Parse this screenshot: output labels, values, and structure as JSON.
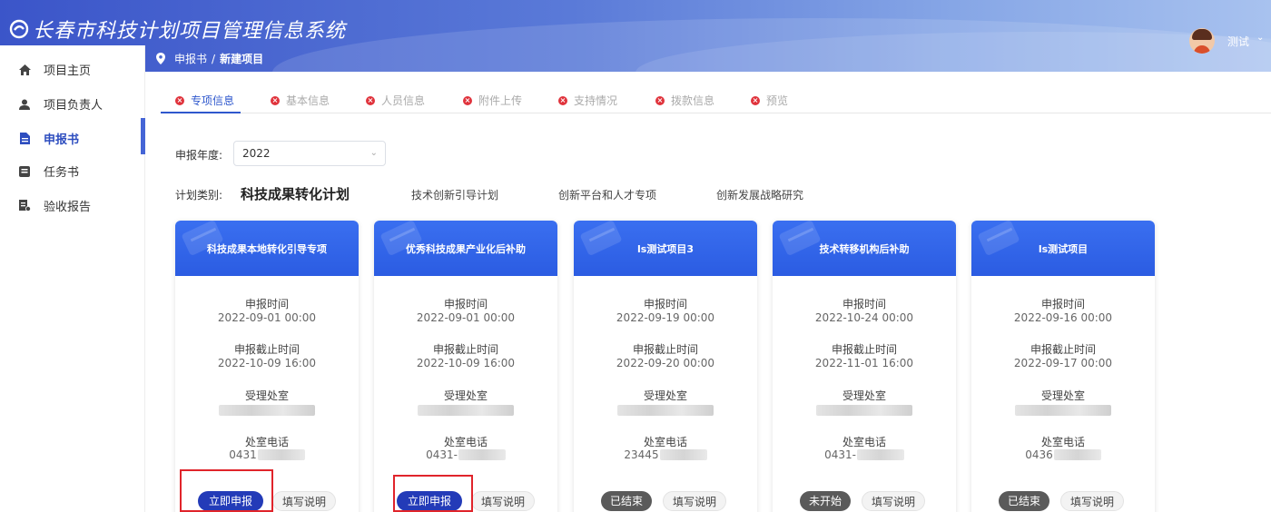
{
  "app": {
    "title": "长春市科技计划项目管理信息系统",
    "user_name": "测试",
    "user_caret": "⌄"
  },
  "breadcrumb": {
    "items": [
      "申报书",
      "新建项目"
    ],
    "separator": "/"
  },
  "sidebar": {
    "items": [
      {
        "label": "项目主页",
        "icon": "home-icon"
      },
      {
        "label": "项目负责人",
        "icon": "user-icon"
      },
      {
        "label": "申报书",
        "icon": "document-icon",
        "active": true
      },
      {
        "label": "任务书",
        "icon": "task-icon"
      },
      {
        "label": "验收报告",
        "icon": "report-icon"
      }
    ]
  },
  "tabs": [
    {
      "label": "专项信息",
      "active": true
    },
    {
      "label": "基本信息"
    },
    {
      "label": "人员信息"
    },
    {
      "label": "附件上传"
    },
    {
      "label": "支持情况"
    },
    {
      "label": "拨款信息"
    },
    {
      "label": "预览"
    }
  ],
  "filters": {
    "year_label": "申报年度:",
    "year_value": "2022",
    "category_label": "计划类别:",
    "categories": [
      {
        "label": "科技成果转化计划",
        "active": true
      },
      {
        "label": "技术创新引导计划"
      },
      {
        "label": "创新平台和人才专项"
      },
      {
        "label": "创新发展战略研究"
      }
    ]
  },
  "labels": {
    "apply_time": "申报时间",
    "deadline": "申报截止时间",
    "office": "受理处室",
    "phone": "处室电话",
    "fill_guide": "填写说明"
  },
  "cards": [
    {
      "title": "科技成果本地转化引导专项",
      "apply_time": "2022-09-01 00:00",
      "deadline": "2022-10-09 16:00",
      "phone_prefix": "0431",
      "action": "立即申报",
      "action_type": "primary"
    },
    {
      "title": "优秀科技成果产业化后补助",
      "apply_time": "2022-09-01 00:00",
      "deadline": "2022-10-09 16:00",
      "phone_prefix": "0431-",
      "action": "立即申报",
      "action_type": "primary"
    },
    {
      "title": "ls测试项目3",
      "apply_time": "2022-09-19 00:00",
      "deadline": "2022-09-20 00:00",
      "phone_prefix": "23445",
      "action": "已结束",
      "action_type": "grey"
    },
    {
      "title": "技术转移机构后补助",
      "apply_time": "2022-10-24 00:00",
      "deadline": "2022-11-01 16:00",
      "phone_prefix": "0431-",
      "action": "未开始",
      "action_type": "grey"
    },
    {
      "title": "ls测试项目",
      "apply_time": "2022-09-16 00:00",
      "deadline": "2022-09-17 00:00",
      "phone_prefix": "0436",
      "action": "已结束",
      "action_type": "grey"
    }
  ],
  "colors": {
    "brand": "#3b55c9",
    "card_header": "#2b5ce2",
    "primary_button": "#233bb8",
    "highlight": "#e0242b",
    "tab_error": "#e0333c"
  }
}
